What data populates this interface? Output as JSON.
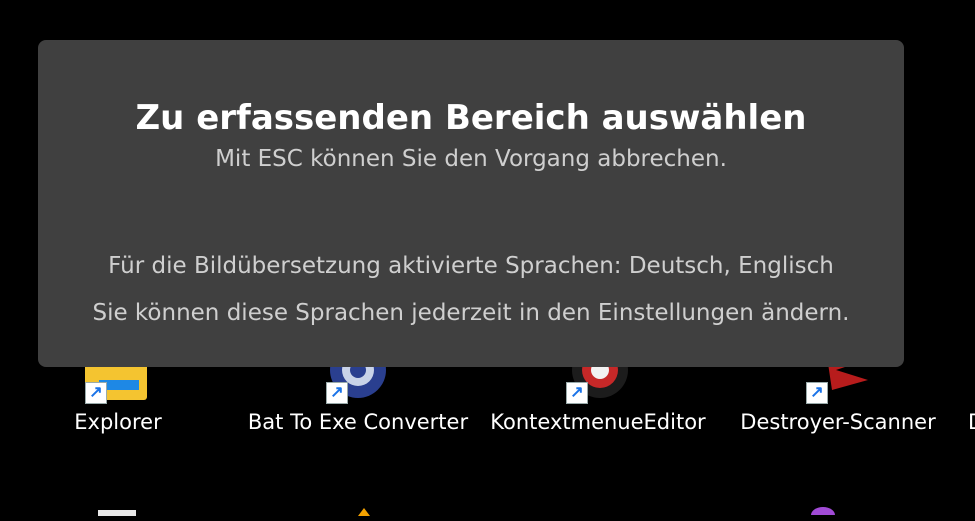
{
  "overlay": {
    "title": "Zu erfassenden Bereich auswählen",
    "esc_hint": "Mit ESC können Sie den Vorgang abbrechen.",
    "languages_line": "Für die Bildübersetzung aktivierte Sprachen: Deutsch, Englisch",
    "settings_line": "Sie können diese Sprachen jederzeit in den Einstellungen ändern."
  },
  "desktop": {
    "icons": [
      {
        "label": "Explorer",
        "icon": "folder-icon"
      },
      {
        "label": "Bat To Exe Converter",
        "icon": "gear-app-icon"
      },
      {
        "label": "KontextmenueEditor",
        "icon": "editor-app-icon"
      },
      {
        "label": "Destroyer-Scanner",
        "icon": "scanner-app-icon"
      },
      {
        "label": "D",
        "icon": "partial-icon"
      }
    ]
  },
  "colors": {
    "desktop_bg": "#000000",
    "overlay_bg": "#404040",
    "title_text": "#ffffff",
    "body_text": "#cfcfcf"
  }
}
